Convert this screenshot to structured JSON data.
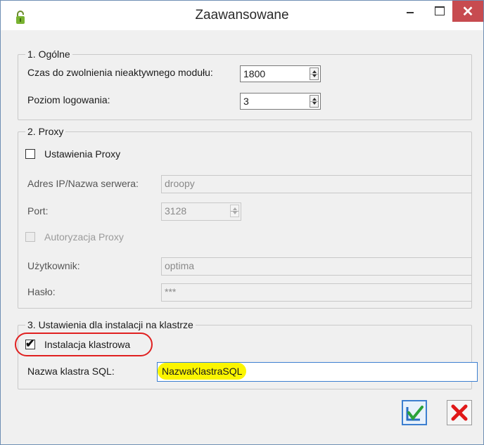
{
  "window": {
    "title": "Zaawansowane",
    "close_glyph": "✕"
  },
  "icons": {
    "app": "lock-icon",
    "min": "minimize-icon",
    "max": "maximize-icon",
    "close": "close-icon",
    "ok": "save-check-icon",
    "cancel": "cancel-x-icon"
  },
  "general": {
    "legend": "1. Ogólne",
    "timeout_label": "Czas do zwolnienia nieaktywnego modułu:",
    "timeout_value": "1800",
    "log_label": "Poziom logowania:",
    "log_value": "3"
  },
  "proxy": {
    "legend": "2. Proxy",
    "settings_label": "Ustawienia Proxy",
    "settings_checked": false,
    "address_label": "Adres IP/Nazwa serwera:",
    "address_value": "droopy",
    "port_label": "Port:",
    "port_value": "3128",
    "auth_label": "Autoryzacja Proxy",
    "user_label": "Użytkownik:",
    "user_value": "optima",
    "password_label": "Hasło:",
    "password_value": "***"
  },
  "cluster": {
    "legend": "3. Ustawienia dla instalacji na klastrze",
    "install_label": "Instalacja klastrowa",
    "install_checked": true,
    "sql_label": "Nazwa klastra SQL:",
    "sql_value": "NazwaKlastraSQL"
  },
  "colors": {
    "close_bg": "#c74b50",
    "highlight": "#fbf500",
    "ring": "#e02020",
    "ok_border": "#3c7fd0"
  }
}
